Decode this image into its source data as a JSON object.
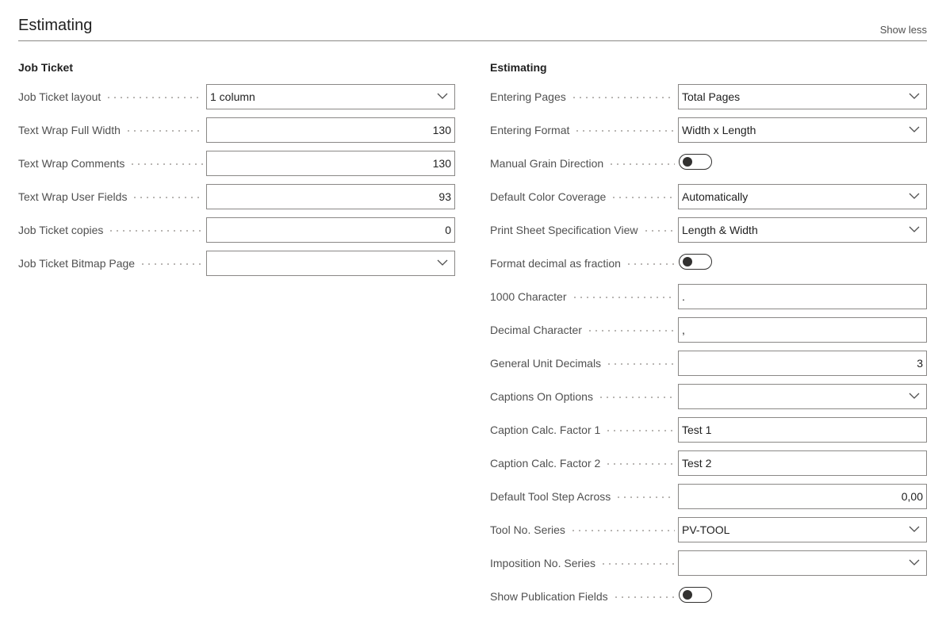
{
  "header": {
    "title": "Estimating",
    "show_less": "Show less"
  },
  "job_ticket": {
    "title": "Job Ticket",
    "layout_label": "Job Ticket layout",
    "layout_value": "1 column",
    "wrap_full_label": "Text Wrap Full Width",
    "wrap_full_value": "130",
    "wrap_comments_label": "Text Wrap Comments",
    "wrap_comments_value": "130",
    "wrap_user_label": "Text Wrap User Fields",
    "wrap_user_value": "93",
    "copies_label": "Job Ticket copies",
    "copies_value": "0",
    "bitmap_label": "Job Ticket Bitmap Page",
    "bitmap_value": ""
  },
  "estimating": {
    "title": "Estimating",
    "entering_pages_label": "Entering Pages",
    "entering_pages_value": "Total Pages",
    "entering_format_label": "Entering Format",
    "entering_format_value": "Width x Length",
    "manual_grain_label": "Manual Grain Direction",
    "default_color_label": "Default Color Coverage",
    "default_color_value": "Automatically",
    "print_sheet_label": "Print Sheet Specification View",
    "print_sheet_value": "Length & Width",
    "format_fraction_label": "Format decimal as fraction",
    "thousand_char_label": "1000 Character",
    "thousand_char_value": ".",
    "decimal_char_label": "Decimal Character",
    "decimal_char_value": ",",
    "unit_decimals_label": "General Unit Decimals",
    "unit_decimals_value": "3",
    "captions_options_label": "Captions On Options",
    "captions_options_value": "",
    "caption_factor1_label": "Caption Calc. Factor 1",
    "caption_factor1_value": "Test 1",
    "caption_factor2_label": "Caption Calc. Factor 2",
    "caption_factor2_value": "Test 2",
    "tool_step_label": "Default Tool Step Across",
    "tool_step_value": "0,00",
    "tool_series_label": "Tool No. Series",
    "tool_series_value": "PV-TOOL",
    "imposition_series_label": "Imposition No. Series",
    "imposition_series_value": "",
    "publication_label": "Show Publication Fields"
  },
  "icons": {
    "dropdown": "chevron-down-icon"
  },
  "colors": {
    "border": "#8a8886",
    "text": "#212121",
    "label": "#505050",
    "toggle": "#323130"
  }
}
